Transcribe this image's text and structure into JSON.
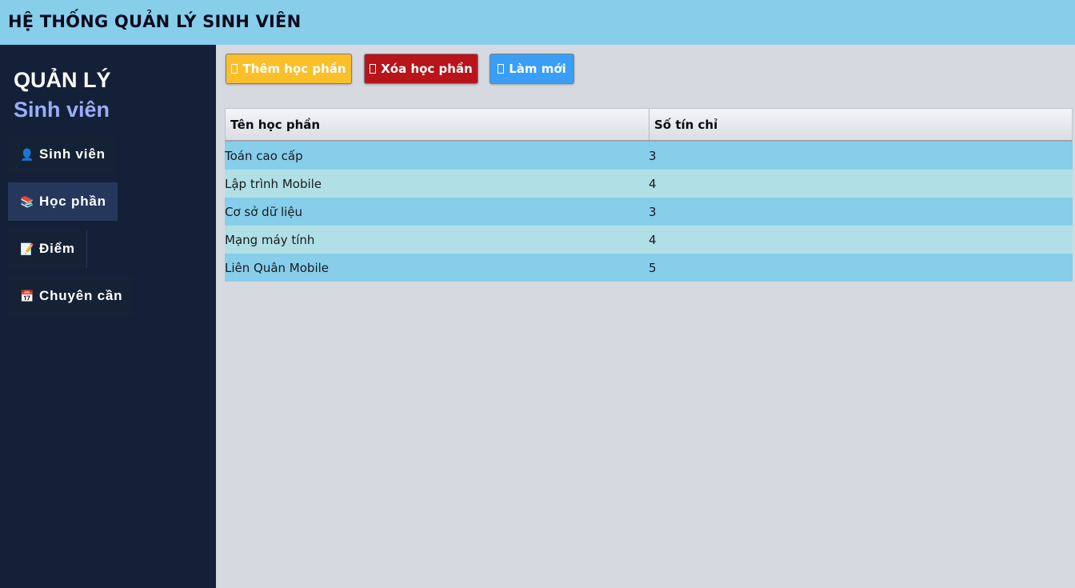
{
  "header": {
    "title": "HỆ THỐNG QUẢN LÝ SINH VIÊN"
  },
  "sidebar": {
    "brand_line1": "QUẢN LÝ",
    "brand_line2": "Sinh viên",
    "items": [
      {
        "icon": "person-icon",
        "glyph": "👤",
        "label": "Sinh viên",
        "active": false
      },
      {
        "icon": "books-icon",
        "glyph": "📚",
        "label": "Học phần",
        "active": true
      },
      {
        "icon": "memo-edit-icon",
        "glyph": "📝",
        "label": "Điểm",
        "active": false
      },
      {
        "icon": "calendar-icon",
        "glyph": "📅",
        "label": "Chuyên cần",
        "active": false
      }
    ]
  },
  "toolbar": {
    "add_label": "Thêm học phần",
    "delete_label": "Xóa học phần",
    "refresh_label": "Làm mới"
  },
  "colors": {
    "header_bg": "#87ceeb",
    "sidebar_bg": "#142037",
    "sidebar_active": "#25385c",
    "brand_accent": "#9aaef8",
    "btn_add": "#fbbf2a",
    "btn_delete": "#b8141a",
    "btn_refresh": "#3a9df6",
    "row_odd": "#87ceeb",
    "row_even": "#b0e0e6"
  },
  "table": {
    "columns": [
      "Tên học phần",
      "Số tín chỉ"
    ],
    "rows": [
      [
        "Toán cao cấp",
        "3"
      ],
      [
        "Lập trình Mobile",
        "4"
      ],
      [
        "Cơ sở dữ liệu",
        "3"
      ],
      [
        "Mạng máy tính",
        "4"
      ],
      [
        "Liên Quân Mobile",
        "5"
      ]
    ]
  }
}
